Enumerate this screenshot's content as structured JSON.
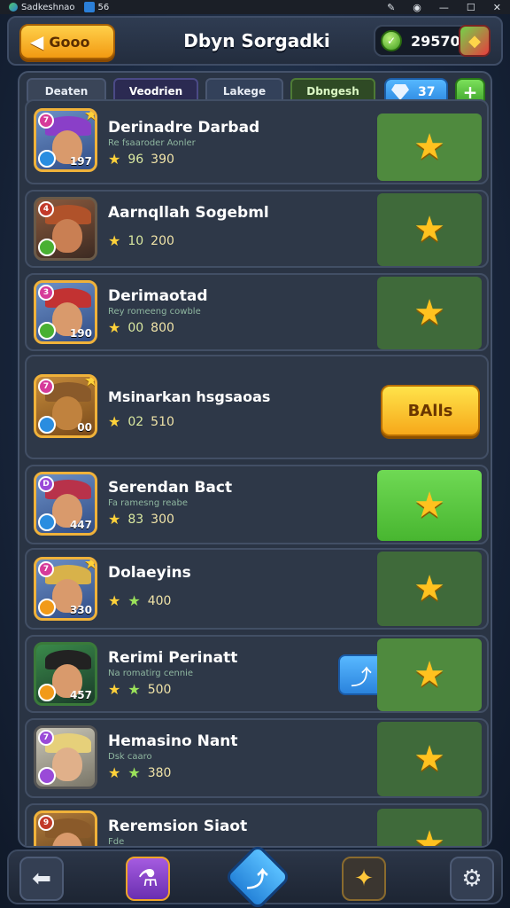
{
  "os": {
    "app_name": "Sadkeshnao",
    "num": "56"
  },
  "header": {
    "back_label": "Gooo",
    "title": "Dbyn Sorgadki",
    "coins": "29570"
  },
  "tabs": [
    "Deaten",
    "Veodrien",
    "Lakege",
    "Dbngesh"
  ],
  "gems": "37",
  "rows": [
    {
      "name": "Derinadre Darbad",
      "sub": "Re fsaaroder Aonler",
      "stat1": "96",
      "stat2": "390",
      "level": "197"
    },
    {
      "name": "Aarnqllah Sogebml",
      "sub": "",
      "stat1": "10",
      "stat2": "200",
      "level": ""
    },
    {
      "name": "Derimaotad",
      "sub": "Rey romeeng cowble",
      "stat1": "00",
      "stat2": "800",
      "level": "190"
    },
    {
      "name": "Msinarkan hsgsaoas",
      "sub": "",
      "stat1": "02",
      "stat2": "510",
      "level": "00",
      "button": "BAlls"
    },
    {
      "name": "Serendan Bact",
      "sub": "Fa ramesng reabe",
      "stat1": "83",
      "stat2": "300",
      "level": "447"
    },
    {
      "name": "Dolaeyins",
      "sub": "",
      "stat1": "",
      "stat2": "400",
      "level": "330"
    },
    {
      "name": "Rerimi Perinatt",
      "sub": "Na romatirg cennie",
      "stat1": "",
      "stat2": "500",
      "level": "457"
    },
    {
      "name": "Hemasino Nant",
      "sub": "Dsk caaro",
      "stat1": "",
      "stat2": "380",
      "level": ""
    },
    {
      "name": "Reremsion Siaot",
      "sub": "Fde",
      "stat1": "",
      "stat2": "",
      "level": ""
    }
  ]
}
